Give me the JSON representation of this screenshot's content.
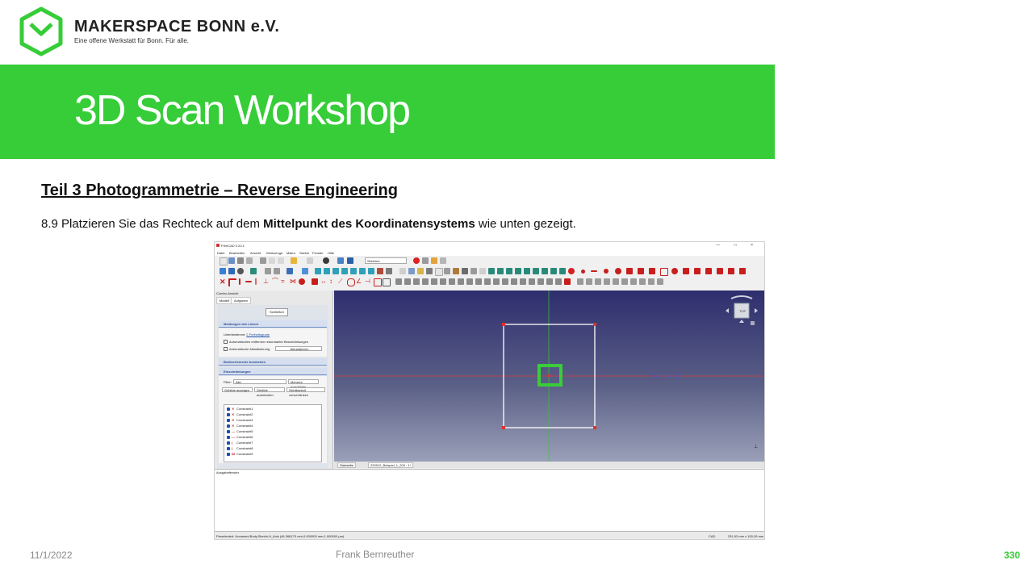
{
  "header": {
    "org_name": "MAKERSPACE BONN e.V.",
    "org_tagline": "Eine offene Werkstatt für Bonn. Für alle."
  },
  "banner": {
    "title": "3D Scan Workshop",
    "color": "#36cd38"
  },
  "content": {
    "section_heading": "Teil 3  Photogrammetrie  – Reverse Engineering",
    "step_prefix": "8.9 Platzieren Sie das Rechteck auf dem ",
    "step_bold": "Mittelpunkt des Koordinatensystems",
    "step_suffix": " wie unten gezeigt."
  },
  "screenshot": {
    "window_title": "FreeCAD 0.20.1",
    "window_controls": "— □ ×",
    "menu": [
      "Datei",
      "Bearbeiten",
      "Ansicht",
      "Werkzeuge",
      "Makro",
      "Sketch",
      "Fenster",
      "Hilfe"
    ],
    "workbench": "Sketcher",
    "panel_title": "Combo-Ansicht",
    "panel_tabs": [
      "Modell",
      "Aufgaben"
    ],
    "close_button": "Schließen",
    "section_solver": "Meldungen des Lösers",
    "solver_text": "Unterbestimmt:",
    "solver_link": "2 Freiheitsgrade",
    "check_auto_remove": "Automatisches entfernen redundanter Beschränkungen",
    "check_auto_update": "Automatische Aktualisierung",
    "update_button": "Aktualisieren",
    "section_edit": "Bedienelemente bearbeiten",
    "section_constraints": "Einschränkungen",
    "filter_label": "Filter:",
    "filter_value": "Alle",
    "multi_select_button": "Mehrere auswählen",
    "show_btn": "Gebilde anzeigen",
    "hide_btn": "Gebilde ausblenden",
    "visibility_btn": "Sichtbarkeit verschränken",
    "constraints": [
      {
        "name": "Constraint1",
        "symbol": "✕"
      },
      {
        "name": "Constraint2",
        "symbol": "✕"
      },
      {
        "name": "Constraint3",
        "symbol": "✕"
      },
      {
        "name": "Constraint4",
        "symbol": "✕"
      },
      {
        "name": "Constraint5",
        "symbol": "—"
      },
      {
        "name": "Constraint6",
        "symbol": "—"
      },
      {
        "name": "Constraint7",
        "symbol": "|"
      },
      {
        "name": "Constraint8",
        "symbol": "|"
      },
      {
        "name": "Constraint9",
        "symbol": "⋈"
      }
    ],
    "section_elements": "Elemente",
    "coord_readout": "(67.3, -0.4)",
    "navcube_label": "TOP",
    "view_tabs": [
      "Startseite",
      "220912_Beispiel_1_200 : 1*"
    ],
    "report_title": "Ausgabefenster",
    "status_text": "Preselected: Unnamed.Body.Sketch.H_Axis (46.368170 mm,0.000000 mm,1.000000 µm)",
    "status_cad": "CAD",
    "status_dims": "251,93 mm x 100,39 mm"
  },
  "footer": {
    "date": "11/1/2022",
    "author": "Frank Bernreuther",
    "page": "330"
  }
}
